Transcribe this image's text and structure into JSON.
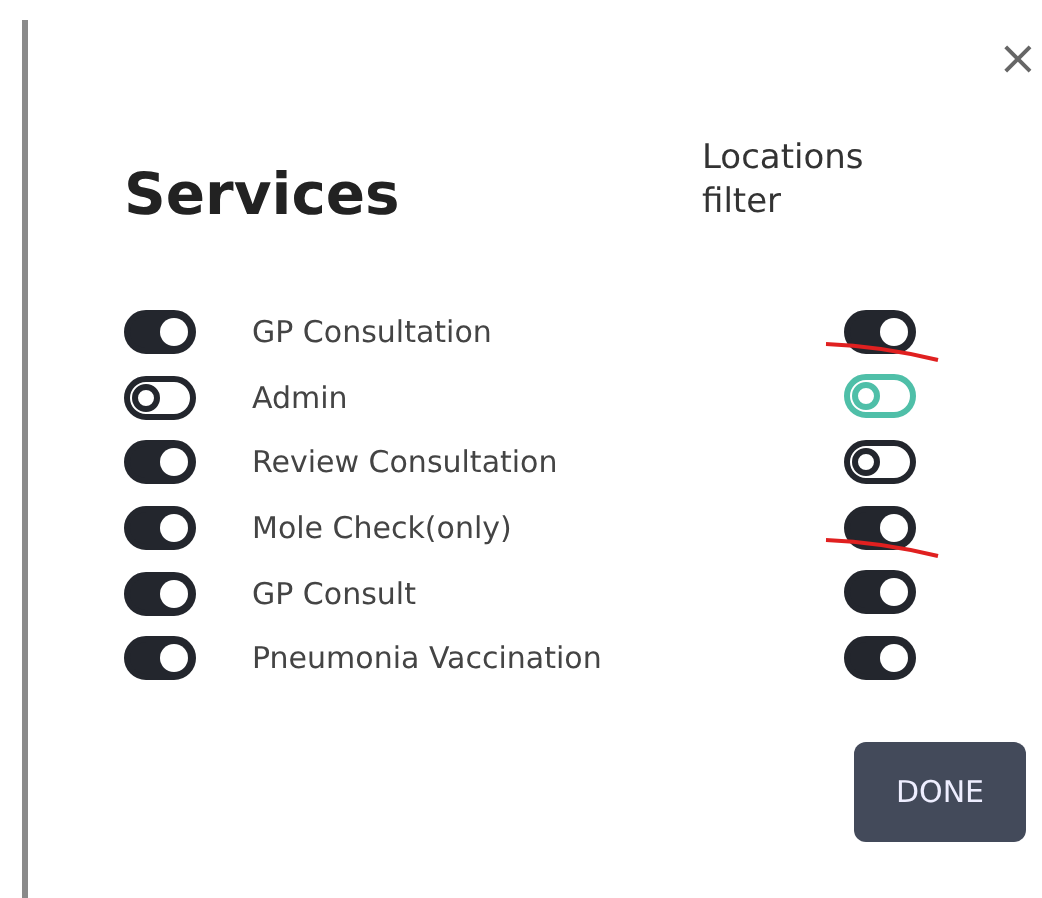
{
  "close": "×",
  "title": "Services",
  "filter_heading": "Locations filter",
  "services": [
    {
      "name": "GP Consultation",
      "on": true,
      "location": {
        "on": true,
        "color": "#23262d",
        "annotated": true
      }
    },
    {
      "name": "Admin",
      "on": false,
      "location": {
        "on": false,
        "color": "#4fbfa8",
        "annotated": false
      }
    },
    {
      "name": "Review Consultation",
      "on": true,
      "location": {
        "on": false,
        "color": "#23262d",
        "annotated": false
      }
    },
    {
      "name": "Mole Check(only)",
      "on": true,
      "location": {
        "on": true,
        "color": "#23262d",
        "annotated": true
      }
    },
    {
      "name": "GP Consult",
      "on": true,
      "location": {
        "on": true,
        "color": "#23262d",
        "annotated": false
      }
    },
    {
      "name": "Pneumonia Vaccination",
      "on": true,
      "location": {
        "on": true,
        "color": "#23262d",
        "annotated": false
      }
    }
  ],
  "done": "DONE"
}
